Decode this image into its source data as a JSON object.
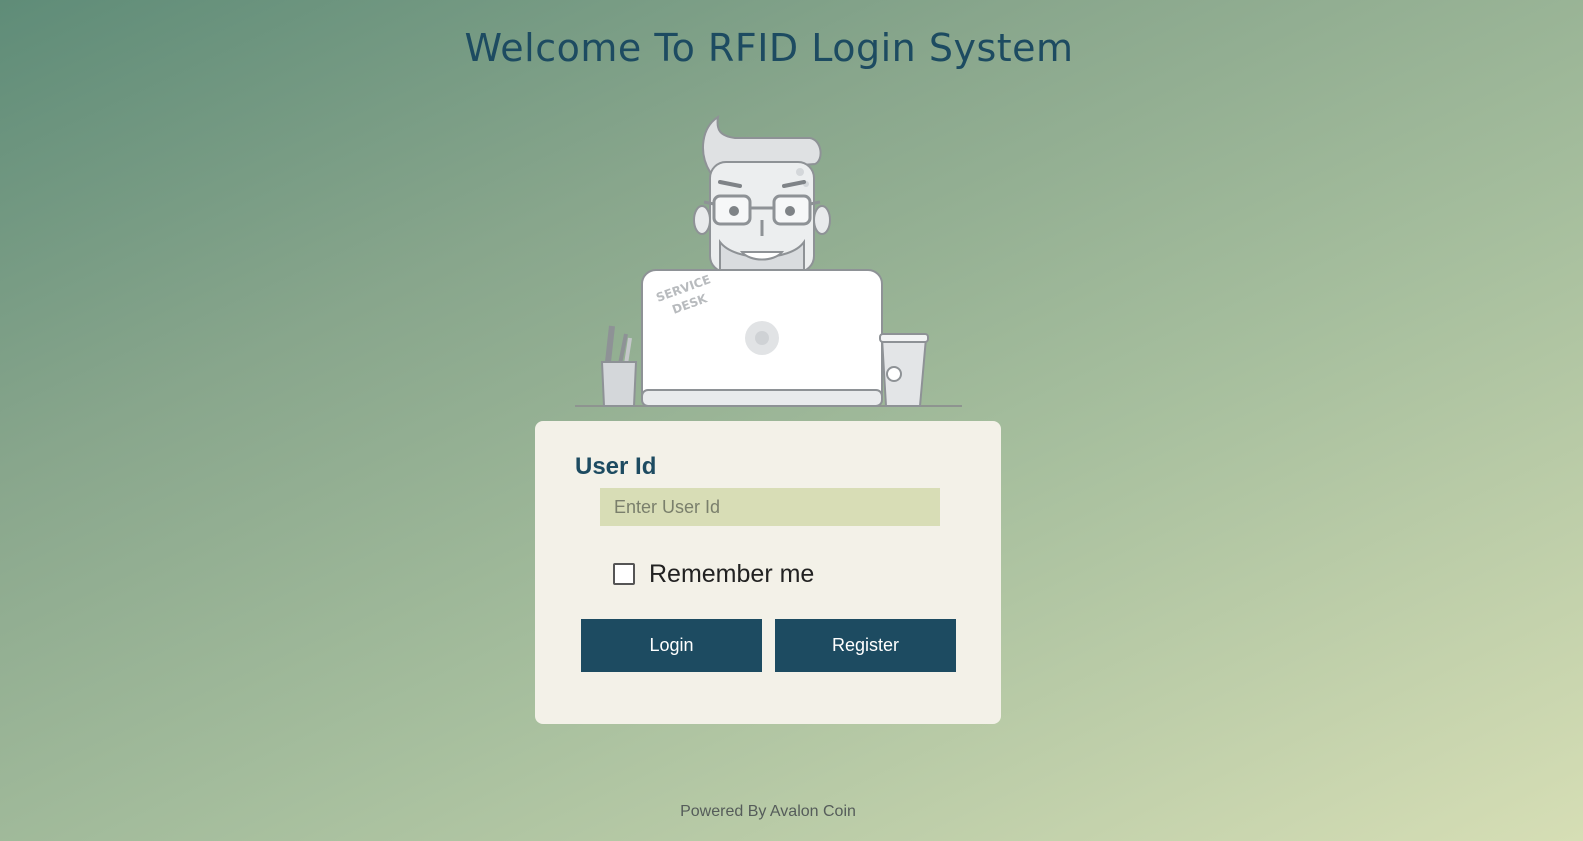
{
  "header": {
    "title": "Welcome To RFID Login System"
  },
  "illustration": {
    "laptop_sticker_line1": "SERVICE",
    "laptop_sticker_line2": "DESK",
    "icon": "service-desk-person-illustration"
  },
  "login_form": {
    "user_id_label": "User Id",
    "user_id_placeholder": "Enter User Id",
    "user_id_value": "",
    "remember_me_label": "Remember me",
    "remember_me_checked": false,
    "login_button": "Login",
    "register_button": "Register"
  },
  "footer": {
    "text": "Powered By Avalon Coin"
  },
  "colors": {
    "primary": "#1d4b61",
    "card_background": "#f3f1e8",
    "input_background": "#d8ddb6"
  }
}
